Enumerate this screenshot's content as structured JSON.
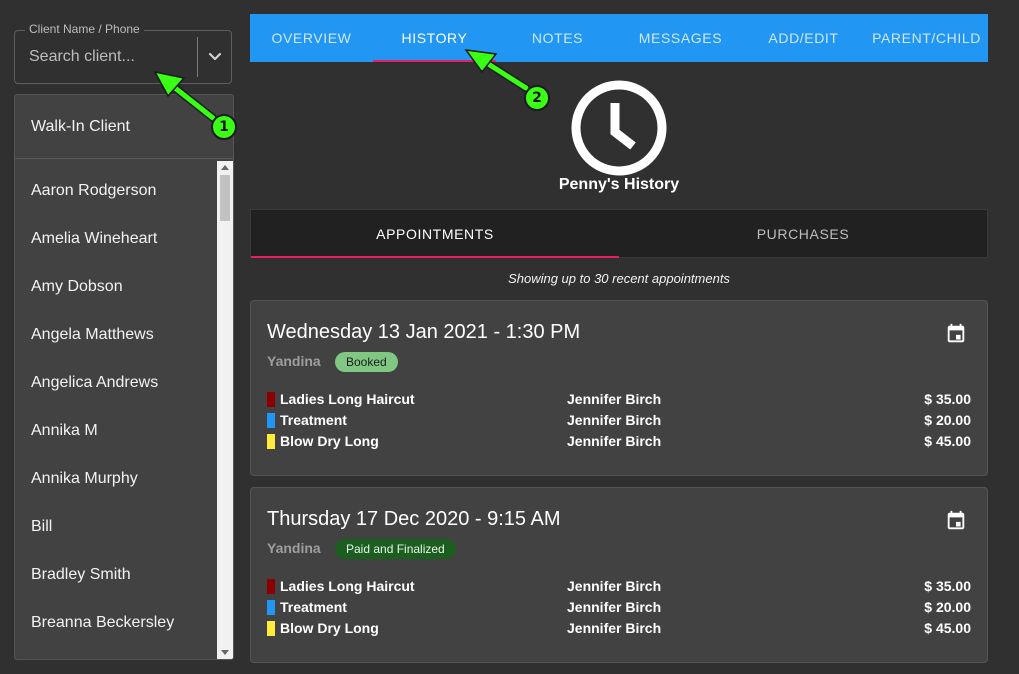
{
  "search": {
    "label": "Client Name / Phone",
    "placeholder": "Search client..."
  },
  "client_list": {
    "walk_in": "Walk-In Client",
    "items": [
      "Aaron Rodgerson",
      "Amelia Wineheart",
      "Amy Dobson",
      "Angela Matthews",
      "Angelica Andrews",
      "Annika M",
      "Annika Murphy",
      "Bill",
      "Bradley Smith",
      "Breanna Beckersley"
    ]
  },
  "top_tabs": [
    "OVERVIEW",
    "HISTORY",
    "NOTES",
    "MESSAGES",
    "ADD/EDIT",
    "PARENT/CHILD"
  ],
  "active_top_tab": "HISTORY",
  "history": {
    "title": "Penny's History",
    "icon": "clock-icon",
    "sub_tabs": [
      "APPOINTMENTS",
      "PURCHASES"
    ],
    "active_sub_tab": "APPOINTMENTS",
    "note": "Showing up to 30 recent appointments"
  },
  "appointments": [
    {
      "date": "Wednesday 13 Jan 2021 - 1:30 PM",
      "location": "Yandina",
      "status": "Booked",
      "services": [
        {
          "name": "Ladies Long Haircut",
          "staff": "Jennifer Birch",
          "price": "$ 35.00",
          "color": "#8b0000"
        },
        {
          "name": "Treatment",
          "staff": "Jennifer Birch",
          "price": "$ 20.00",
          "color": "#2196f3"
        },
        {
          "name": "Blow Dry Long",
          "staff": "Jennifer Birch",
          "price": "$ 45.00",
          "color": "#ffeb3b"
        }
      ]
    },
    {
      "date": "Thursday 17 Dec 2020 - 9:15 AM",
      "location": "Yandina",
      "status": "Paid and Finalized",
      "services": [
        {
          "name": "Ladies Long Haircut",
          "staff": "Jennifer Birch",
          "price": "$ 35.00",
          "color": "#8b0000"
        },
        {
          "name": "Treatment",
          "staff": "Jennifer Birch",
          "price": "$ 20.00",
          "color": "#2196f3"
        },
        {
          "name": "Blow Dry Long",
          "staff": "Jennifer Birch",
          "price": "$ 45.00",
          "color": "#ffeb3b"
        }
      ]
    }
  ],
  "annotations": [
    "1",
    "2"
  ],
  "colors": {
    "background": "#303030",
    "primary": "#2196f3",
    "accent": "#e91e63",
    "annotation": "#39ff14",
    "status_booked": "#81c784",
    "status_paid": "#1b5e20"
  }
}
